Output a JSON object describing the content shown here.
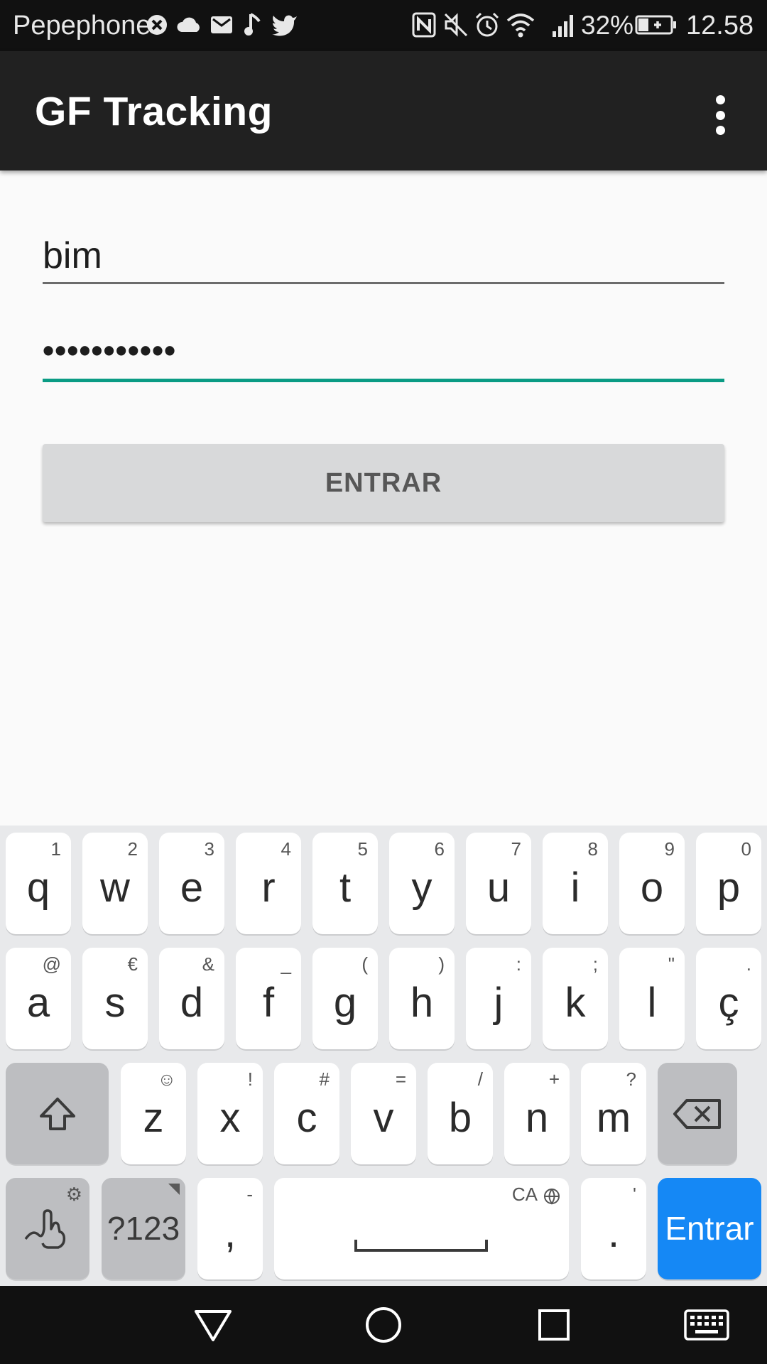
{
  "status_bar": {
    "carrier": "Pepephone",
    "battery_percent": "32%",
    "time": "12.58",
    "icons": [
      "vpn-icon",
      "cloud-icon",
      "mail-icon",
      "music-icon",
      "twitter-icon",
      "nfc-icon",
      "mute-icon",
      "alarm-icon",
      "wifi-icon",
      "signal-icon",
      "battery-charging-icon"
    ]
  },
  "app_bar": {
    "title": "GF Tracking",
    "menu_icon": "overflow-menu-icon"
  },
  "form": {
    "username_value": "bim",
    "password_value": "•••••••••••",
    "submit_label": "ENTRAR",
    "accent_color": "#0a9b84"
  },
  "keyboard": {
    "row1": [
      {
        "main": "q",
        "hint": "1"
      },
      {
        "main": "w",
        "hint": "2"
      },
      {
        "main": "e",
        "hint": "3"
      },
      {
        "main": "r",
        "hint": "4"
      },
      {
        "main": "t",
        "hint": "5"
      },
      {
        "main": "y",
        "hint": "6"
      },
      {
        "main": "u",
        "hint": "7"
      },
      {
        "main": "i",
        "hint": "8"
      },
      {
        "main": "o",
        "hint": "9"
      },
      {
        "main": "p",
        "hint": "0"
      }
    ],
    "row2": [
      {
        "main": "a",
        "hint": "@"
      },
      {
        "main": "s",
        "hint": "€"
      },
      {
        "main": "d",
        "hint": "&"
      },
      {
        "main": "f",
        "hint": "_"
      },
      {
        "main": "g",
        "hint": "("
      },
      {
        "main": "h",
        "hint": ")"
      },
      {
        "main": "j",
        "hint": ":"
      },
      {
        "main": "k",
        "hint": ";"
      },
      {
        "main": "l",
        "hint": "\""
      },
      {
        "main": "ç",
        "hint": "."
      }
    ],
    "row3": [
      {
        "main": "z",
        "hint": "☺"
      },
      {
        "main": "x",
        "hint": "!"
      },
      {
        "main": "c",
        "hint": "#"
      },
      {
        "main": "v",
        "hint": "="
      },
      {
        "main": "b",
        "hint": "/"
      },
      {
        "main": "n",
        "hint": "+"
      },
      {
        "main": "m",
        "hint": "?"
      }
    ],
    "symbols_label": "?123",
    "comma": {
      "main": ",",
      "hint": "-"
    },
    "space_hint": "CA",
    "period": {
      "main": ".",
      "hint": "'"
    },
    "enter_label": "Entrar",
    "enter_color": "#1588f5"
  },
  "nav_bar": {
    "buttons": [
      "back-icon",
      "home-icon",
      "recents-icon",
      "keyboard-icon"
    ]
  }
}
